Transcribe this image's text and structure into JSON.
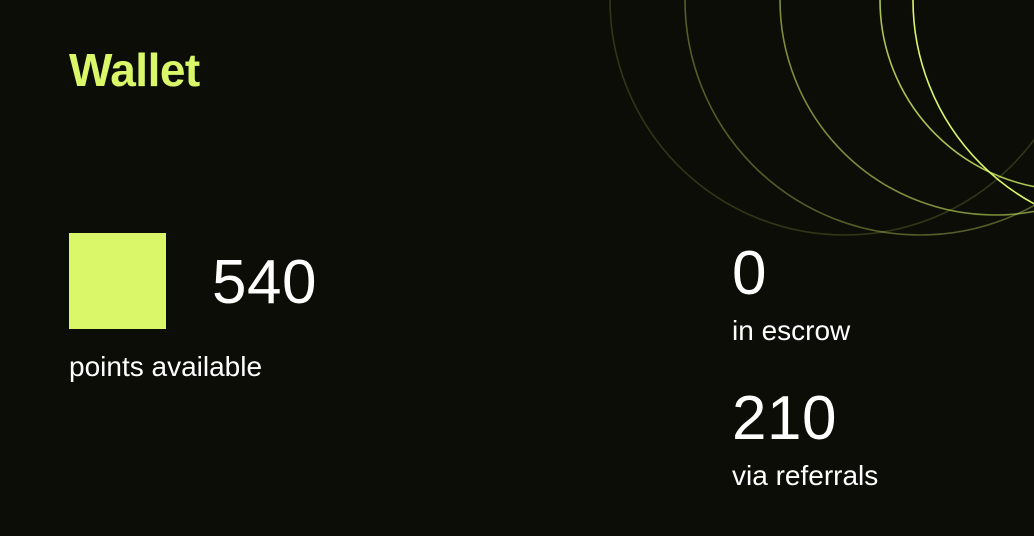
{
  "wallet": {
    "title": "Wallet",
    "accent_color": "#d9f769",
    "available": {
      "value": "540",
      "label": "points available"
    },
    "escrow": {
      "value": "0",
      "label": "in escrow"
    },
    "referrals": {
      "value": "210",
      "label": "via referrals"
    }
  }
}
